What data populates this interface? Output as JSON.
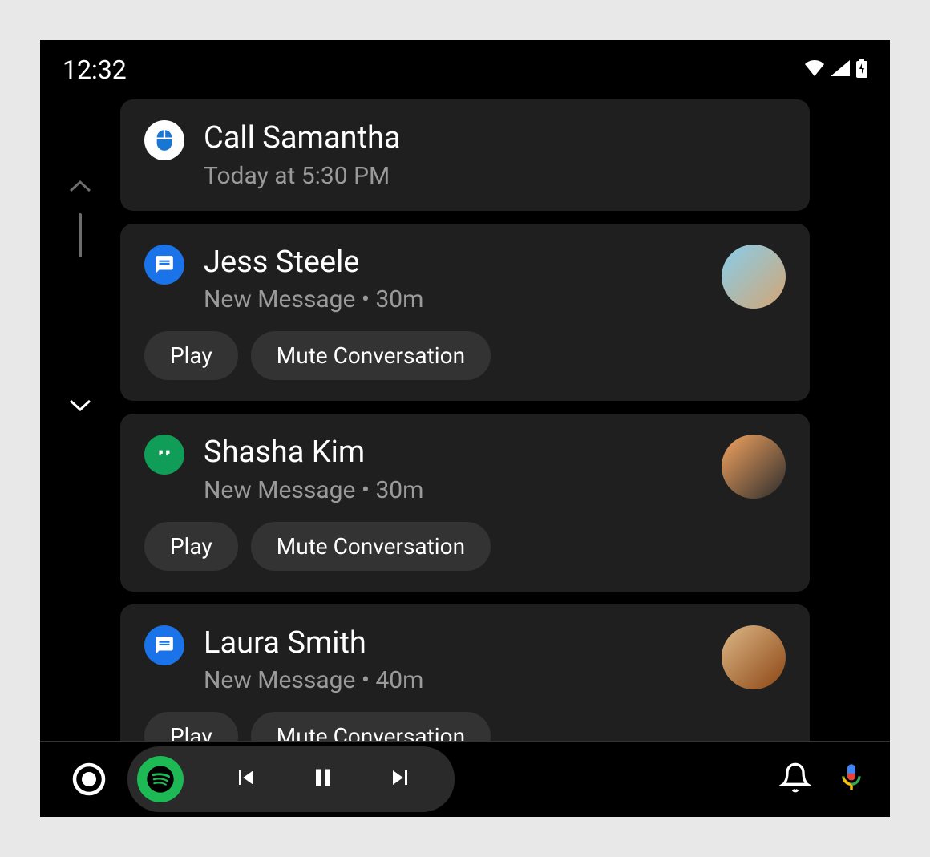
{
  "statusBar": {
    "time": "12:32"
  },
  "notifications": [
    {
      "title": "Call Samantha",
      "subtitle": "Today at 5:30 PM",
      "iconType": "reminder",
      "hasAvatar": false,
      "hasActions": false
    },
    {
      "title": "Jess Steele",
      "subtitle": "New Message • 30m",
      "iconType": "messages",
      "hasAvatar": true,
      "hasActions": true,
      "actions": [
        "Play",
        "Mute Conversation"
      ]
    },
    {
      "title": "Shasha Kim",
      "subtitle": "New Message • 30m",
      "iconType": "hangouts",
      "hasAvatar": true,
      "hasActions": true,
      "actions": [
        "Play",
        "Mute Conversation"
      ]
    },
    {
      "title": "Laura Smith",
      "subtitle": "New Message • 40m",
      "iconType": "messages",
      "hasAvatar": true,
      "hasActions": true,
      "actions": [
        "Play",
        "Mute Conversation"
      ]
    }
  ],
  "iconNames": {
    "wifi": "wifi-icon",
    "signal": "signal-icon",
    "battery": "battery-charging-icon",
    "reminder": "gesture-icon",
    "messages": "messages-icon",
    "hangouts": "hangouts-icon",
    "home": "home-circle-icon",
    "spotify": "spotify-icon",
    "prev": "skip-previous-icon",
    "pause": "pause-icon",
    "next": "skip-next-icon",
    "bell": "notifications-icon",
    "mic": "microphone-icon"
  }
}
